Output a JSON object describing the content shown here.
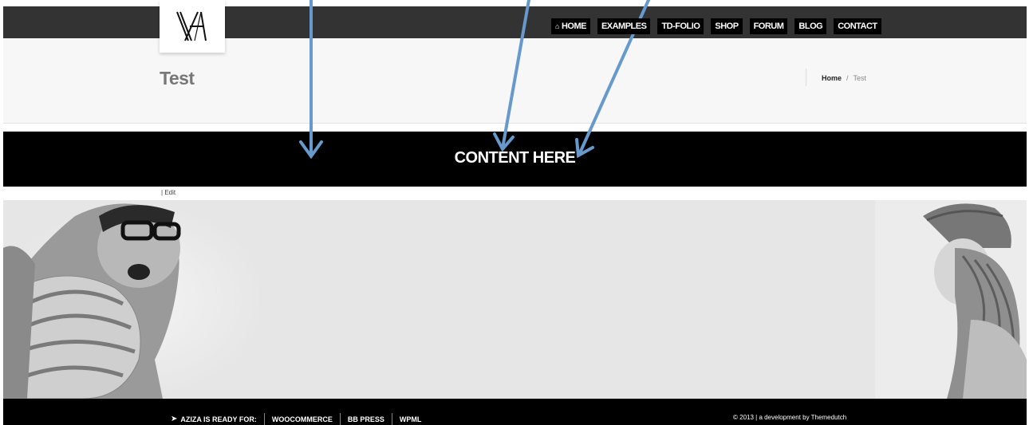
{
  "brand": {
    "logo_mark": "ẞA-monogram"
  },
  "nav": {
    "home_icon": "house-icon",
    "items": [
      {
        "label": "HOME"
      },
      {
        "label": "EXAMPLES"
      },
      {
        "label": "TD-FOLIO"
      },
      {
        "label": "SHOP"
      },
      {
        "label": "FORUM"
      },
      {
        "label": "BLOG"
      },
      {
        "label": "CONTACT"
      }
    ]
  },
  "page": {
    "title": "Test"
  },
  "breadcrumb": {
    "home": "Home",
    "separator": "/",
    "current": "Test"
  },
  "content": {
    "text": "CONTENT HERE"
  },
  "edit": {
    "separator": "|",
    "label": "Edit"
  },
  "footer": {
    "ready_icon": "paper-plane-icon",
    "ready_label": "AZIZA IS READY FOR:",
    "links": [
      "WOOCOMMERCE",
      "BB PRESS",
      "WPML"
    ],
    "copyright": "© 2013 | a development by Themedutch"
  },
  "colors": {
    "nav_bar": "#333333",
    "nav_button": "#000000",
    "title_band": "#f7f7f7",
    "content_band": "#000000",
    "arrow": "#6699cc",
    "footer": "#000000"
  }
}
